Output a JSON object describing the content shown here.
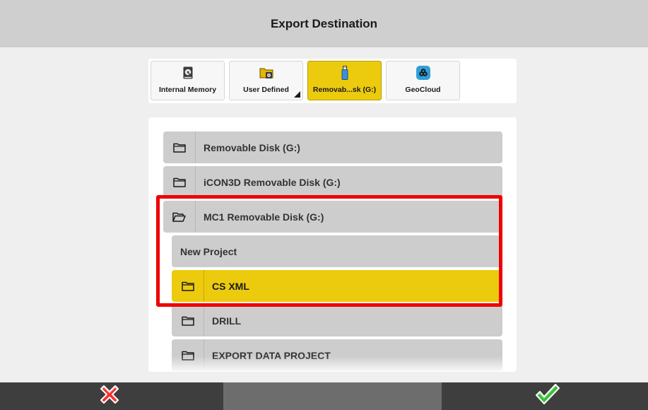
{
  "dialog": {
    "title": "Export Destination"
  },
  "tabs": [
    {
      "label": "Internal Memory",
      "icon": "hard-drive-icon",
      "active": false
    },
    {
      "label": "User Defined",
      "icon": "folder-drive-icon",
      "active": false
    },
    {
      "label": "Removab...sk (G:)",
      "icon": "usb-drive-icon",
      "active": true
    },
    {
      "label": "GeoCloud",
      "icon": "cloud-icon",
      "active": false
    }
  ],
  "list": {
    "items": [
      {
        "label": "Removable Disk (G:)",
        "icon": "folder-icon"
      },
      {
        "label": "iCON3D Removable Disk (G:)",
        "icon": "folder-icon"
      },
      {
        "label": "MC1 Removable Disk (G:)",
        "icon": "folder-open-icon"
      },
      {
        "label": "New Project"
      },
      {
        "label": "CS XML",
        "icon": "folder-icon",
        "selected": true
      },
      {
        "label": "DRILL",
        "icon": "folder-icon"
      },
      {
        "label": "EXPORT DATA PROJECT",
        "icon": "folder-icon"
      }
    ]
  },
  "footer": {
    "cancel_icon": "red-x-icon",
    "confirm_icon": "green-check-icon"
  },
  "colors": {
    "accent": "#eccb0e",
    "highlight": "#ee0000",
    "header_bg": "#cfcfcf",
    "footer_bg": "#3e3e3e"
  }
}
